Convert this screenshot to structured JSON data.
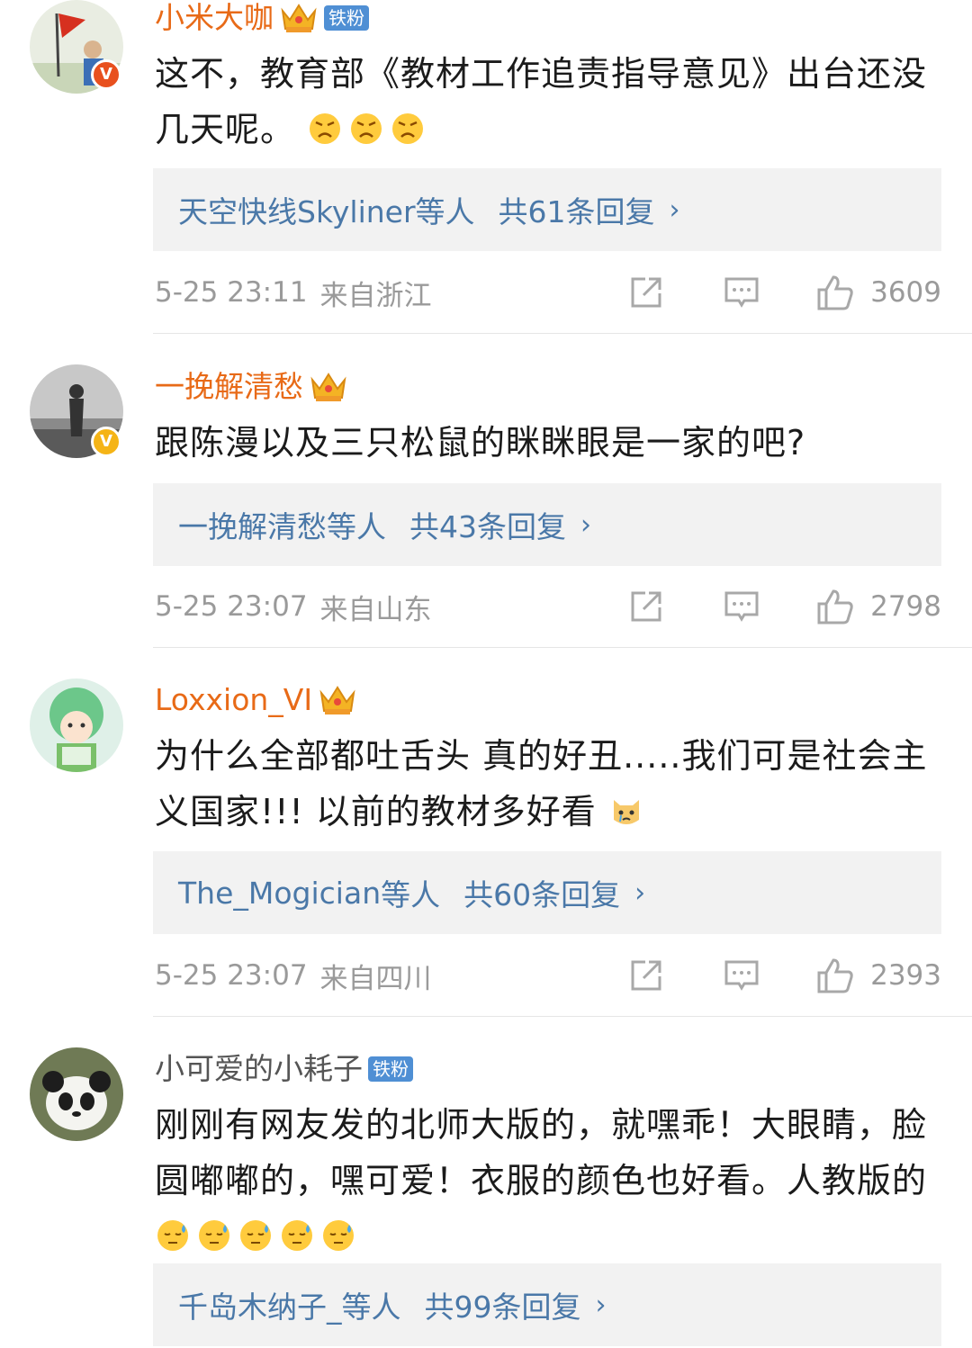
{
  "comments": [
    {
      "username": "小米大咖",
      "fan_badge": "铁粉",
      "text": "这不，教育部《教材工作追责指导意见》出台还没几天呢。",
      "reply_user": "天空快线Skyliner",
      "reply_suffix": "等人",
      "reply_count": "共61条回复",
      "time": "5-25 23:11",
      "location": "来自浙江",
      "likes": "3609"
    },
    {
      "username": "一挽解清愁",
      "text": "跟陈漫以及三只松鼠的眯眯眼是一家的吧?",
      "reply_user": "一挽解清愁",
      "reply_suffix": "等人",
      "reply_count": "共43条回复",
      "time": "5-25 23:07",
      "location": "来自山东",
      "likes": "2798"
    },
    {
      "username": "Loxxion_VI",
      "text": "为什么全部都吐舌头 真的好丑.....我们可是社会主义国家!!! 以前的教材多好看",
      "reply_user": "The_Mogician",
      "reply_suffix": "等人",
      "reply_count": "共60条回复",
      "time": "5-25 23:07",
      "location": "来自四川",
      "likes": "2393"
    },
    {
      "username": "小可爱的小耗子",
      "fan_badge": "铁粉",
      "text": "刚刚有网友发的北师大版的，就嘿乖！大眼睛，脸圆嘟嘟的，嘿可爱！衣服的颜色也好看。人教版的",
      "reply_user": "千岛木纳子_",
      "reply_suffix": "等人",
      "reply_count": "共99条回复"
    }
  ],
  "badges": {
    "verified_1": "V",
    "verified_2": "V"
  },
  "icons": {
    "share": "share-icon",
    "reply": "comment-icon",
    "like": "thumbs-up-icon",
    "chevron": "›"
  },
  "colors": {
    "username_vip": "#e86a17",
    "reply_link": "#4a78a8",
    "meta": "#9a9a9a",
    "reply_bg": "#f2f2f2"
  }
}
